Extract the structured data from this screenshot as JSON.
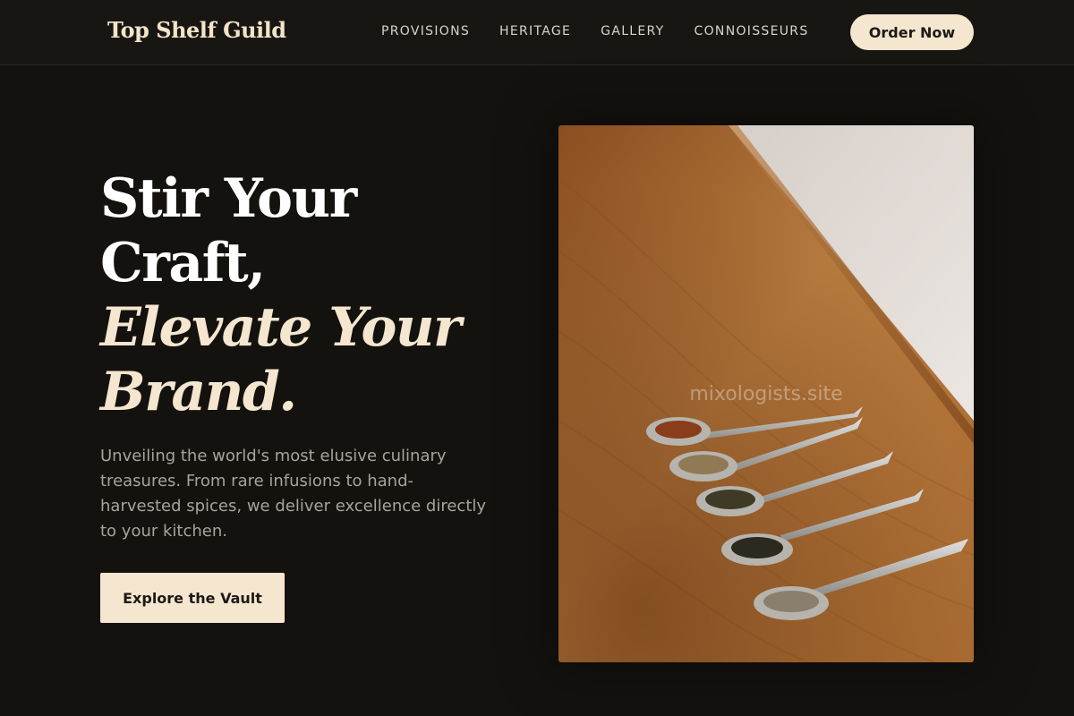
{
  "header": {
    "brand": "Top Shelf Guild",
    "nav": [
      "PROVISIONS",
      "HERITAGE",
      "GALLERY",
      "CONNOISSEURS"
    ],
    "cta_label": "Order Now"
  },
  "hero": {
    "title_lines": [
      "Stir Your",
      "Craft,"
    ],
    "accent_lines": [
      "Elevate Your",
      "Brand."
    ],
    "description": "Unveiling the world's most elusive culinary treasures. From rare infusions to hand-harvested spices, we deliver excellence directly to your kitchen.",
    "button_label": "Explore the Vault",
    "image": {
      "watermark": "mixologists.site"
    }
  },
  "colors": {
    "background": "#14120f",
    "accent": "#f5e6cf",
    "text_muted": "#a8a39b"
  }
}
